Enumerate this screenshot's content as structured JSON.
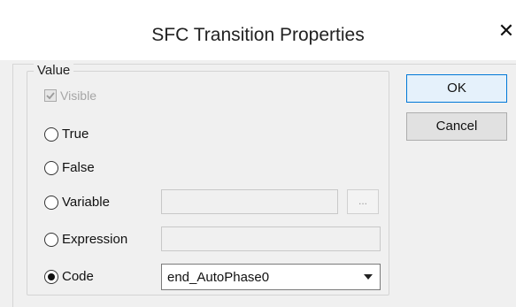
{
  "dialog": {
    "title": "SFC Transition Properties",
    "close_glyph": "✕"
  },
  "group": {
    "legend": "Value",
    "visible_checkbox": {
      "label": "Visible",
      "checked": true,
      "enabled": false
    }
  },
  "options": [
    {
      "label": "True",
      "selected": false
    },
    {
      "label": "False",
      "selected": false
    },
    {
      "label": "Variable",
      "selected": false
    },
    {
      "label": "Expression",
      "selected": false
    },
    {
      "label": "Code",
      "selected": true
    }
  ],
  "variable_browse_label": "...",
  "code_combo": {
    "value": "end_AutoPhase0"
  },
  "buttons": {
    "ok": "OK",
    "cancel": "Cancel"
  },
  "icons": {
    "checkmark": "check-icon",
    "dropdown": "chevron-down-icon",
    "close": "close-icon"
  },
  "colors": {
    "default_button_border": "#0078d7",
    "client_background": "#f0f0f0"
  }
}
